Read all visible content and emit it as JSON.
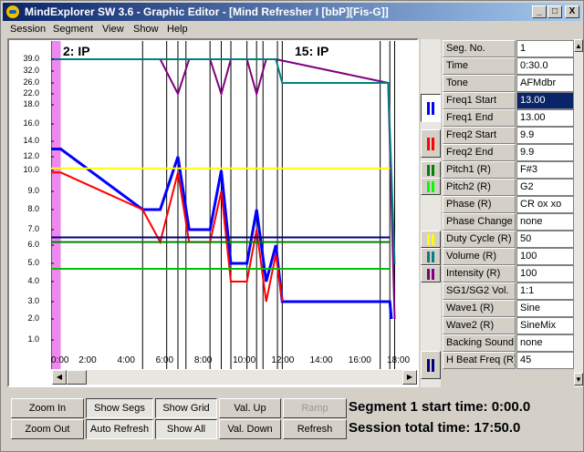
{
  "window": {
    "title": "MindExplorer SW 3.6 - Graphic Editor - [Mind Refresher I [bbP][Fis-G]]",
    "controls": {
      "minimize": "_",
      "maximize": "□",
      "close": "X"
    }
  },
  "menu": [
    "Session",
    "Segment",
    "View",
    "Show",
    "Help"
  ],
  "graph": {
    "segment_labels": [
      "2: IP",
      "15: IP"
    ],
    "y_ticks": [
      "39.0",
      "32.0",
      "26.0",
      "22.0",
      "18.0",
      "16.0",
      "14.0",
      "12.0",
      "10.0",
      "9.0",
      "8.0",
      "7.0",
      "6.0",
      "5.0",
      "4.0",
      "3.0",
      "2.0",
      "1.0"
    ],
    "x_ticks": [
      "0:00",
      "2:00",
      "4:00",
      "6:00",
      "8:00",
      "10:00",
      "12:00",
      "14:00",
      "16:00",
      "18:00"
    ]
  },
  "chart_data": {
    "type": "line",
    "xlabel": "",
    "ylabel": "",
    "xlim": [
      "0:00",
      "18:00"
    ],
    "y_scale": "non-linear (tick values 1.0 to 39.0)",
    "grid": false,
    "segment_boundaries": [
      "0:00",
      "4:45",
      "6:00",
      "6:35",
      "7:00",
      "8:15",
      "8:50",
      "9:20",
      "10:10",
      "10:40",
      "11:00",
      "11:45",
      "12:00",
      "17:05",
      "17:35",
      "17:50"
    ],
    "series": [
      {
        "color": "#0000ff",
        "x": [
          "0:00",
          "0:30",
          "4:45",
          "5:40",
          "6:35",
          "7:10",
          "8:15",
          "8:50",
          "9:20",
          "10:10",
          "10:40",
          "11:10",
          "11:40",
          "12:00",
          "17:35",
          "17:40"
        ],
        "values": [
          13.0,
          13.0,
          8.0,
          8.0,
          12.0,
          7.0,
          7.0,
          10.0,
          5.0,
          5.0,
          8.0,
          4.0,
          6.0,
          3.0,
          3.0,
          2.0
        ]
      },
      {
        "color": "#ff0000",
        "x": [
          "0:00",
          "0:30",
          "4:45",
          "5:40",
          "6:35",
          "7:10",
          "8:15",
          "8:50",
          "9:20",
          "10:10",
          "10:40",
          "11:10",
          "11:40",
          "12:00"
        ],
        "values": [
          9.9,
          9.9,
          8.0,
          6.2,
          9.9,
          6.2,
          6.2,
          9.0,
          4.0,
          4.0,
          7.0,
          3.0,
          5.5,
          3.0
        ]
      },
      {
        "color": "#800080",
        "x": [
          "0:00",
          "5:40",
          "6:35",
          "7:10",
          "8:15",
          "8:50",
          "9:20",
          "10:10",
          "10:40",
          "11:10",
          "11:40",
          "17:30",
          "17:50"
        ],
        "values": [
          39.0,
          39.0,
          22.0,
          39.0,
          39.0,
          22.0,
          39.0,
          39.0,
          22.0,
          39.0,
          39.0,
          26.0,
          2.0
        ]
      },
      {
        "color": "#008080",
        "x": [
          "0:00",
          "11:40",
          "12:00",
          "17:30",
          "17:50"
        ],
        "values": [
          39.0,
          39.0,
          26.0,
          26.0,
          5.0
        ]
      },
      {
        "color": "#ffff00",
        "x": [
          "0:00",
          "17:35"
        ],
        "values": [
          10.3,
          10.3
        ]
      },
      {
        "color": "#00c000",
        "x": [
          "0:00",
          "17:35"
        ],
        "values": [
          4.7,
          4.7
        ]
      },
      {
        "color": "#008000",
        "x": [
          "0:00",
          "17:35"
        ],
        "values": [
          6.2,
          6.2
        ]
      },
      {
        "color": "#000080",
        "x": [
          "0:00",
          "17:35"
        ],
        "values": [
          6.5,
          6.5
        ]
      }
    ]
  },
  "params": [
    {
      "label": "Seg. No.",
      "value": "1"
    },
    {
      "label": "Time",
      "value": "0:30.0"
    },
    {
      "label": "Tone",
      "value": "AFMdbr"
    },
    {
      "label": "Freq1 Start",
      "value": "13.00",
      "selected": true
    },
    {
      "label": "Freq1 End",
      "value": "13.00"
    },
    {
      "label": "Freq2 Start",
      "value": "9.9"
    },
    {
      "label": "Freq2 End",
      "value": "9.9"
    },
    {
      "label": "Pitch1 (R)",
      "value": "F#3"
    },
    {
      "label": "Pitch2 (R)",
      "value": "G2"
    },
    {
      "label": "Phase (R)",
      "value": "CR ox xo"
    },
    {
      "label": "Phase Change",
      "value": "none"
    },
    {
      "label": "Duty Cycle (R)",
      "value": "50"
    },
    {
      "label": "Volume (R)",
      "value": "100"
    },
    {
      "label": "Intensity (R)",
      "value": "100"
    },
    {
      "label": "SG1/SG2 Vol.",
      "value": "1:1"
    },
    {
      "label": "Wave1 (R)",
      "value": "Sine"
    },
    {
      "label": "Wave2 (R)",
      "value": "SineMix"
    },
    {
      "label": "Backing Sound",
      "value": "none"
    },
    {
      "label": "H Beat Freq (R)",
      "value": "45"
    }
  ],
  "swatch_colors": [
    "#0000ff",
    "#ff0000",
    "#008000",
    "#00ff00",
    "#ffff00",
    "#008080",
    "#800080",
    "#000080"
  ],
  "buttons": {
    "zoom_in": "Zoom In",
    "zoom_out": "Zoom Out",
    "show_segs": "Show Segs",
    "auto_refresh": "Auto Refresh",
    "show_grid": "Show Grid",
    "show_all": "Show All",
    "val_up": "Val. Up",
    "val_down": "Val. Down",
    "ramp": "Ramp",
    "refresh": "Refresh"
  },
  "status": {
    "segment_start": "Segment 1 start time: 0:00.0",
    "session_total": "Session total time: 17:50.0"
  }
}
